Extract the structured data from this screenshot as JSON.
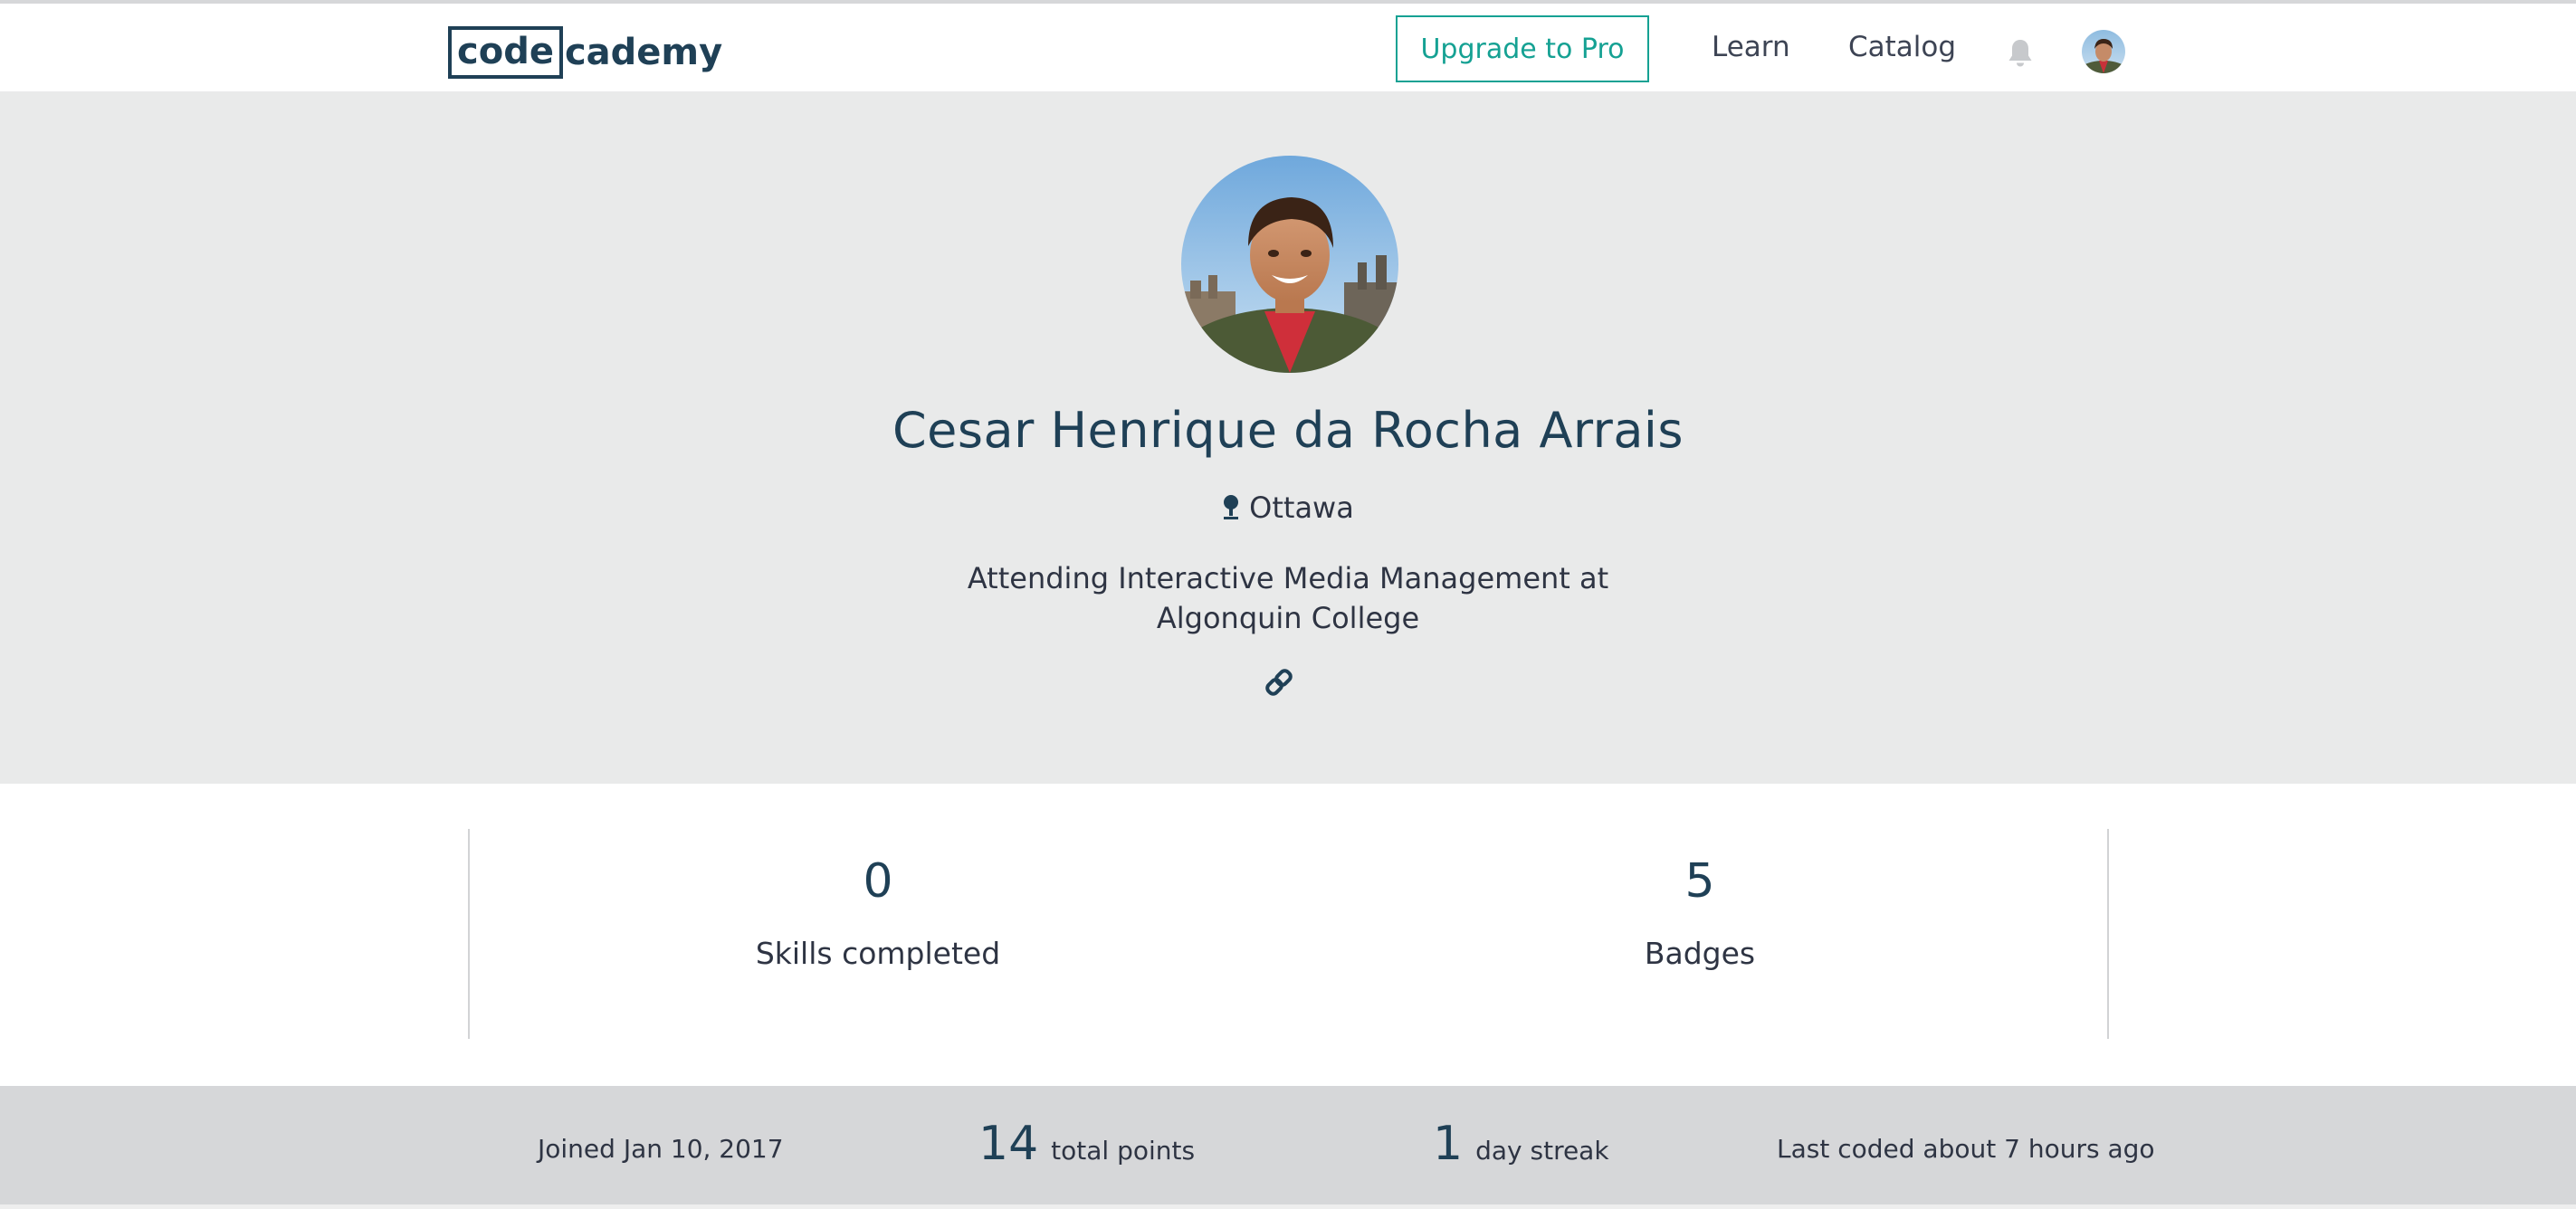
{
  "header": {
    "logo": {
      "boxed": "code",
      "rest": "cademy"
    },
    "upgrade_label": "Upgrade to Pro",
    "nav": {
      "learn": "Learn",
      "catalog": "Catalog"
    },
    "icons": {
      "notifications": "bell-icon",
      "account": "user-avatar"
    }
  },
  "profile": {
    "name": "Cesar Henrique da Rocha Arrais",
    "location": "Ottawa",
    "bio": "Attending Interactive Media Management at Algonquin College",
    "icons": {
      "location": "map-pin-icon",
      "website": "link-icon"
    }
  },
  "stats": [
    {
      "value": "0",
      "label": "Skills completed"
    },
    {
      "value": "5",
      "label": "Badges"
    }
  ],
  "activity": {
    "joined": "Joined Jan 10, 2017",
    "points_value": "14",
    "points_label": "total points",
    "streak_value": "1",
    "streak_label": "day streak",
    "last_coded": "Last coded about 7 hours ago"
  },
  "colors": {
    "brand_navy": "#1f4056",
    "accent_teal": "#15a193",
    "hero_bg": "#e9eaea",
    "footer_bg": "#d6d7d9"
  }
}
